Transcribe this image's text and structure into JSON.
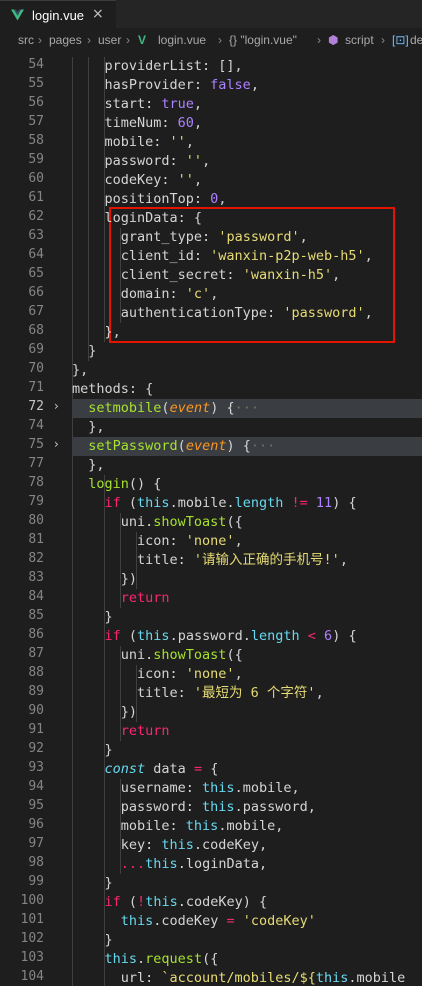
{
  "tab": {
    "filename": "login.vue",
    "close": "×",
    "logo": "vue-logo"
  },
  "breadcrumb": [
    "src",
    "pages",
    "user",
    "login.vue",
    "{} \"login.vue\"",
    "script",
    "de"
  ],
  "lines": [
    {
      "n": "54",
      "html": "    providerList: [],"
    },
    {
      "n": "55",
      "html": "    hasProvider: <span class='v'>false</span>,"
    },
    {
      "n": "56",
      "html": "    start: <span class='v'>true</span>,"
    },
    {
      "n": "57",
      "html": "    timeNum: <span class='v'>60</span>,"
    },
    {
      "n": "58",
      "html": "    mobile: <span class='s'>''</span>,"
    },
    {
      "n": "59",
      "html": "    password: <span class='s'>''</span>,"
    },
    {
      "n": "60",
      "html": "    codeKey: <span class='s'>''</span>,"
    },
    {
      "n": "61",
      "html": "    positionTop: <span class='v'>0</span>,"
    },
    {
      "n": "62",
      "html": "    loginData: {"
    },
    {
      "n": "63",
      "html": "      grant_type: <span class='s'>'password'</span>,"
    },
    {
      "n": "64",
      "html": "      client_id: <span class='s'>'wanxin-p2p-web-h5'</span>,"
    },
    {
      "n": "65",
      "html": "      client_secret: <span class='s'>'wanxin-h5'</span>,"
    },
    {
      "n": "66",
      "html": "      domain: <span class='s'>'c'</span>,"
    },
    {
      "n": "67",
      "html": "      authenticationType: <span class='s'>'password'</span>,"
    },
    {
      "n": "68",
      "html": "    },"
    },
    {
      "n": "69",
      "html": "  }"
    },
    {
      "n": "70",
      "html": "},"
    },
    {
      "n": "71",
      "html": "methods: {"
    },
    {
      "n": "72",
      "html": "  <span class='f'>setmobile</span>(<span class='p'>event</span>) {<span class='e'>···</span>",
      "active": true,
      "fold": true,
      "hl": true
    },
    {
      "n": "74",
      "html": "  },"
    },
    {
      "n": "75",
      "html": "  <span class='f'>setPassword</span>(<span class='p'>event</span>) {<span class='e'>···</span>",
      "fold": true,
      "hl": true
    },
    {
      "n": "77",
      "html": "  },"
    },
    {
      "n": "78",
      "html": "  <span class='f'>login</span>() {"
    },
    {
      "n": "79",
      "html": "    <span class='k'>if</span> (<span class='b'>this</span>.mobile.<span class='b'>length</span> <span class='k'>!=</span> <span class='v'>11</span>) {"
    },
    {
      "n": "80",
      "html": "      uni.<span class='f'>showToast</span>({"
    },
    {
      "n": "81",
      "html": "        icon: <span class='s'>'none'</span>,"
    },
    {
      "n": "82",
      "html": "        title: <span class='s'>'请输入正确的手机号!'</span>,"
    },
    {
      "n": "83",
      "html": "      })"
    },
    {
      "n": "84",
      "html": "      <span class='k'>return</span>"
    },
    {
      "n": "85",
      "html": "    }"
    },
    {
      "n": "86",
      "html": "    <span class='k'>if</span> (<span class='b'>this</span>.password.<span class='b'>length</span> <span class='k'>&lt;</span> <span class='v'>6</span>) {"
    },
    {
      "n": "87",
      "html": "      uni.<span class='f'>showToast</span>({"
    },
    {
      "n": "88",
      "html": "        icon: <span class='s'>'none'</span>,"
    },
    {
      "n": "89",
      "html": "        title: <span class='s'>'最短为 6 个字符'</span>,"
    },
    {
      "n": "90",
      "html": "      })"
    },
    {
      "n": "91",
      "html": "      <span class='k'>return</span>"
    },
    {
      "n": "92",
      "html": "    }"
    },
    {
      "n": "93",
      "html": "    <span class='i'>const</span> data <span class='k'>=</span> {"
    },
    {
      "n": "94",
      "html": "      username: <span class='b'>this</span>.mobile,"
    },
    {
      "n": "95",
      "html": "      password: <span class='b'>this</span>.password,"
    },
    {
      "n": "96",
      "html": "      mobile: <span class='b'>this</span>.mobile,"
    },
    {
      "n": "97",
      "html": "      key: <span class='b'>this</span>.codeKey,"
    },
    {
      "n": "98",
      "html": "      <span class='k'>...</span><span class='b'>this</span>.loginData,"
    },
    {
      "n": "99",
      "html": "    }"
    },
    {
      "n": "100",
      "html": "    <span class='k'>if</span> (<span class='k'>!</span><span class='b'>this</span>.codeKey) {"
    },
    {
      "n": "101",
      "html": "      <span class='b'>this</span>.codeKey <span class='k'>=</span> <span class='s'>'codeKey'</span>"
    },
    {
      "n": "102",
      "html": "    }"
    },
    {
      "n": "103",
      "html": "    <span class='b'>this</span>.<span class='f'>request</span>({"
    },
    {
      "n": "104",
      "html": "      url: <span class='s'>`account/mobiles/${</span><span class='b'>this</span>.mobile"
    }
  ]
}
